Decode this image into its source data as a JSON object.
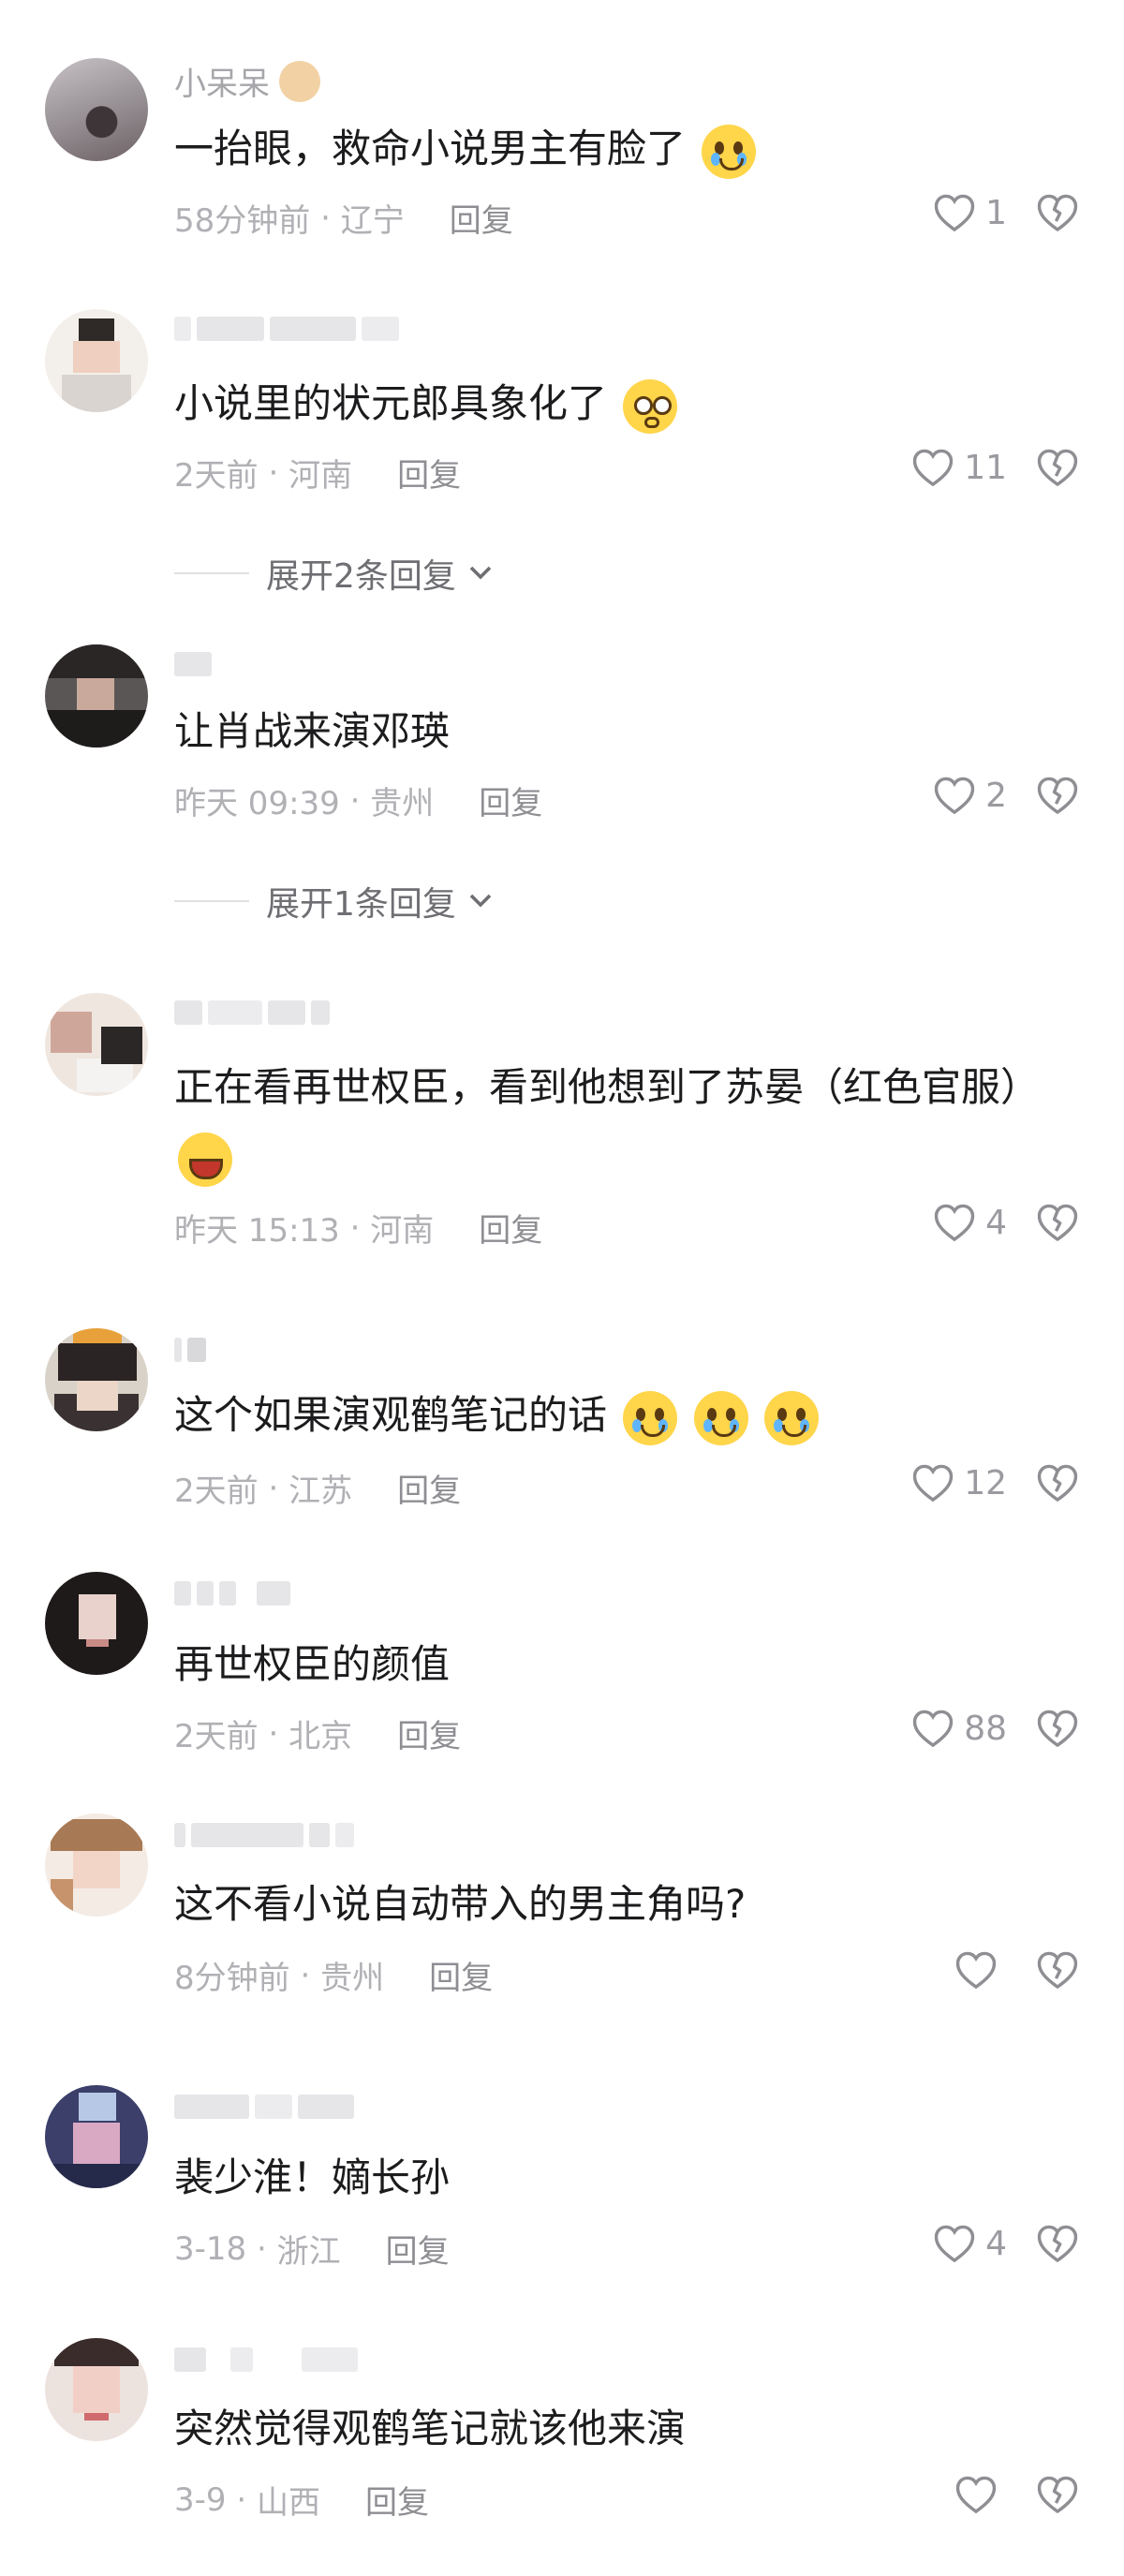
{
  "comments": [
    {
      "name": "小呆呆",
      "text": "一抬眼，救命小说男主有脸了",
      "time": "58分钟前",
      "location": "辽宁",
      "reply": "回复",
      "likes": "1"
    },
    {
      "name": "",
      "text": "小说里的状元郎具象化了",
      "time": "2天前",
      "location": "河南",
      "reply": "回复",
      "likes": "11",
      "expand": "展开2条回复"
    },
    {
      "name": "",
      "text": "让肖战来演邓瑛",
      "time": "昨天 09:39",
      "location": "贵州",
      "reply": "回复",
      "likes": "2",
      "expand": "展开1条回复"
    },
    {
      "name": "",
      "text": "正在看再世权臣，看到他想到了苏晏（红色官服）",
      "time": "昨天 15:13",
      "location": "河南",
      "reply": "回复",
      "likes": "4"
    },
    {
      "name": "",
      "text": "这个如果演观鹤笔记的话",
      "time": "2天前",
      "location": "江苏",
      "reply": "回复",
      "likes": "12"
    },
    {
      "name": "",
      "text": "再世权臣的颜值",
      "time": "2天前",
      "location": "北京",
      "reply": "回复",
      "likes": "88"
    },
    {
      "name": "",
      "text": "这不看小说自动带入的男主角吗?",
      "time": "8分钟前",
      "location": "贵州",
      "reply": "回复",
      "likes": ""
    },
    {
      "name": "",
      "text": "裴少淮！嫡长孙",
      "time": "3-18",
      "location": "浙江",
      "reply": "回复",
      "likes": "4"
    },
    {
      "name": "",
      "text": "突然觉得观鹤笔记就该他来演",
      "time": "3-9",
      "location": "山西",
      "reply": "回复",
      "likes": ""
    }
  ],
  "icons": {
    "like": "heart-outline-icon",
    "dislike": "broken-heart-icon",
    "expand": "chevron-down-icon"
  },
  "colors": {
    "text": "#1c1c1e",
    "meta": "#b0b0b5",
    "icon": "#9a9aa0"
  }
}
